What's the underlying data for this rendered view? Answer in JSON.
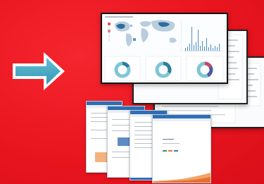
{
  "background_color": "#e9151f",
  "arrow": {
    "icon": "right-arrow-icon",
    "color": "#4aaac2"
  },
  "dashboard_front": {
    "title": "",
    "panels": [
      "world-map",
      "time-series-chart",
      "donut-row"
    ]
  },
  "dashboard_back": {
    "panels": [
      "histogram",
      "donut-chart",
      "table"
    ]
  },
  "documents": {
    "count": 4,
    "accent": "#2f6db5",
    "chart_color": "#f08a3c"
  }
}
